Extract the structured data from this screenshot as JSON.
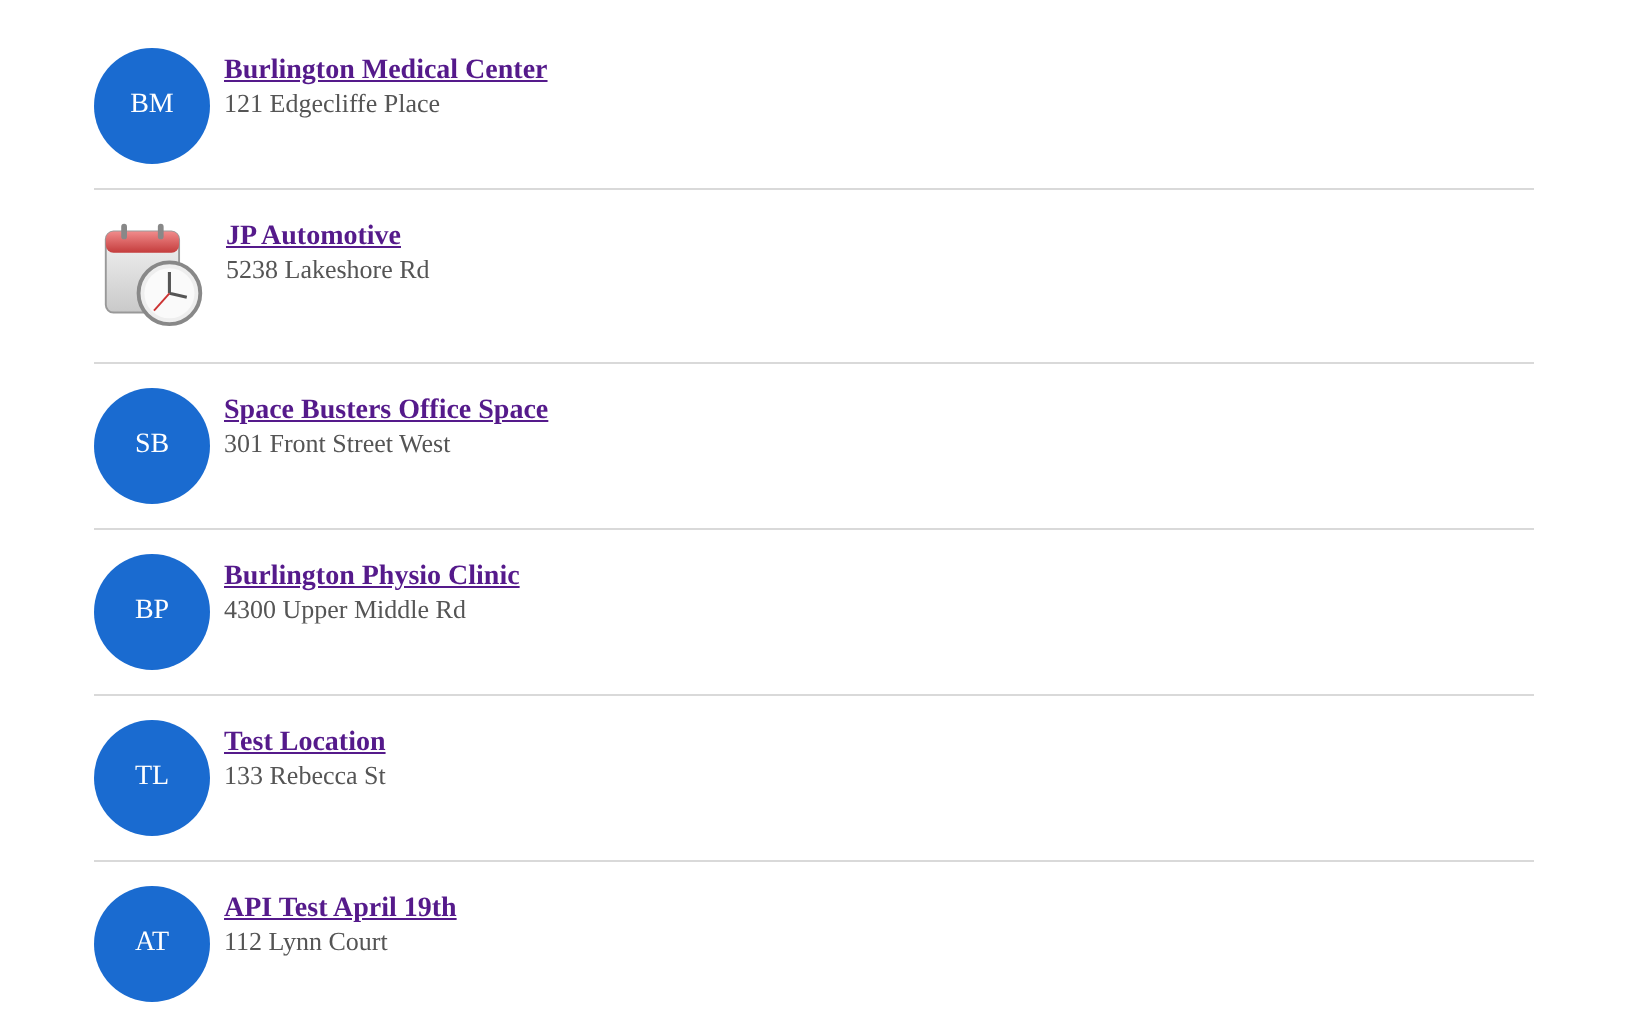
{
  "locations": [
    {
      "kind": "initials",
      "initials": "BM",
      "name": "Burlington Medical Center",
      "address": "121 Edgecliffe Place"
    },
    {
      "kind": "icon",
      "name": "JP Automotive",
      "address": "5238 Lakeshore Rd"
    },
    {
      "kind": "initials",
      "initials": "SB",
      "name": "Space Busters Office Space",
      "address": "301 Front Street West"
    },
    {
      "kind": "initials",
      "initials": "BP",
      "name": "Burlington Physio Clinic",
      "address": "4300 Upper Middle Rd"
    },
    {
      "kind": "initials",
      "initials": "TL",
      "name": "Test Location",
      "address": "133 Rebecca St"
    },
    {
      "kind": "initials",
      "initials": "AT",
      "name": "API Test April 19th",
      "address": "112 Lynn Court"
    }
  ]
}
